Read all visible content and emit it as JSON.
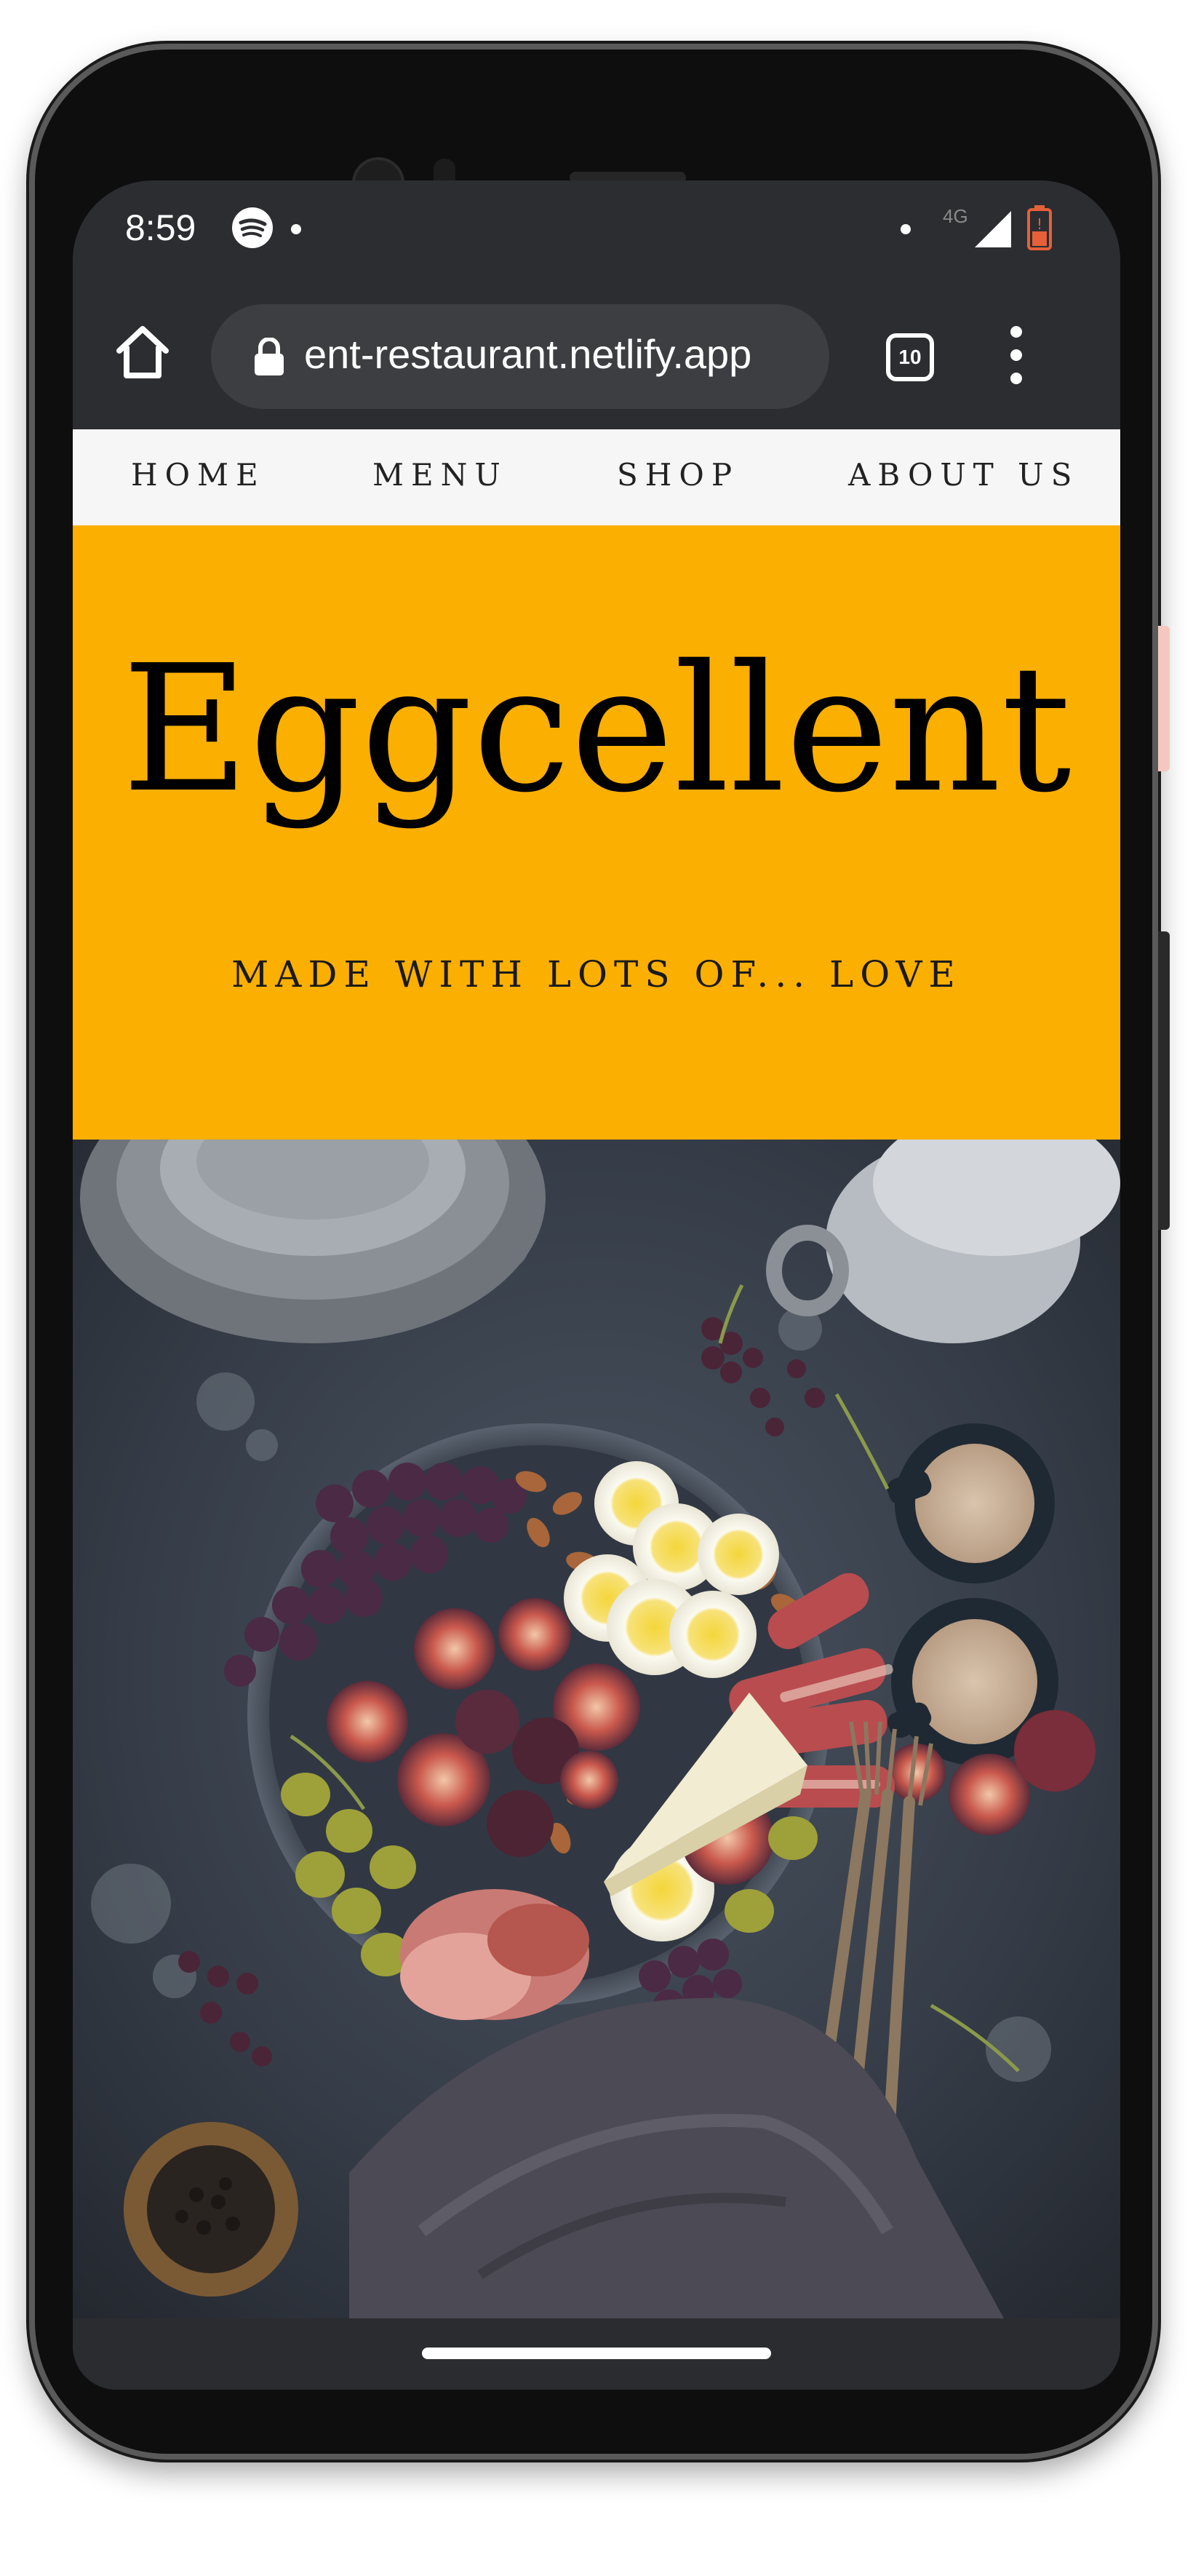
{
  "status_bar": {
    "time": "8:59",
    "network": "4G",
    "icons": [
      "spotify-icon",
      "signal-icon",
      "battery-icon"
    ]
  },
  "browser": {
    "url": "ent-restaurant.netlify.app",
    "tab_count": "10",
    "icons": [
      "home-icon",
      "lock-icon",
      "overflow-menu-icon"
    ]
  },
  "nav": {
    "items": [
      {
        "label": "HOME"
      },
      {
        "label": "MENU"
      },
      {
        "label": "SHOP"
      },
      {
        "label": "ABOUT US"
      }
    ]
  },
  "hero": {
    "title": "Eggcellent",
    "subtitle": "MADE WITH LOTS OF... LOVE",
    "background_color": "#fbaf00"
  }
}
